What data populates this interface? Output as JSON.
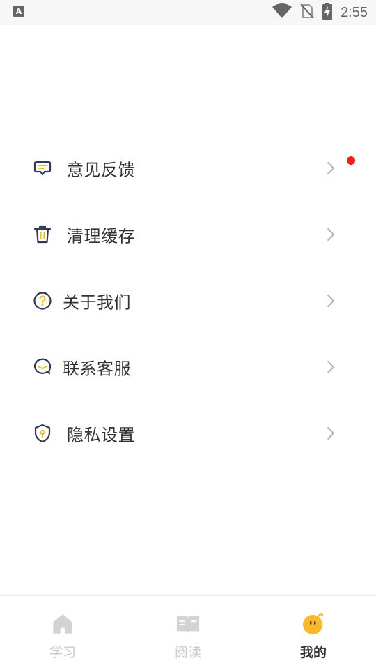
{
  "status_bar": {
    "time": "2:55",
    "icons": [
      "keyboard-a-icon",
      "wifi-icon",
      "no-sim-icon",
      "battery-charging-icon"
    ]
  },
  "menu": {
    "items": [
      {
        "label": "意见反馈",
        "icon": "feedback-icon",
        "has_badge": true
      },
      {
        "label": "清理缓存",
        "icon": "trash-icon",
        "has_badge": false
      },
      {
        "label": "关于我们",
        "icon": "question-icon",
        "has_badge": false
      },
      {
        "label": "联系客服",
        "icon": "customer-service-icon",
        "has_badge": false
      },
      {
        "label": "隐私设置",
        "icon": "privacy-shield-icon",
        "has_badge": false
      }
    ]
  },
  "tab_bar": {
    "tabs": [
      {
        "label": "学习",
        "icon": "home-icon",
        "active": false
      },
      {
        "label": "阅读",
        "icon": "book-icon",
        "active": false
      },
      {
        "label": "我的",
        "icon": "profile-face-icon",
        "active": true
      }
    ]
  },
  "colors": {
    "icon_navy": "#2d3a5a",
    "accent_yellow": "#f9b92a",
    "badge_red": "#f31b1b",
    "text_primary": "#333333",
    "tab_inactive": "#c9c9c9"
  }
}
